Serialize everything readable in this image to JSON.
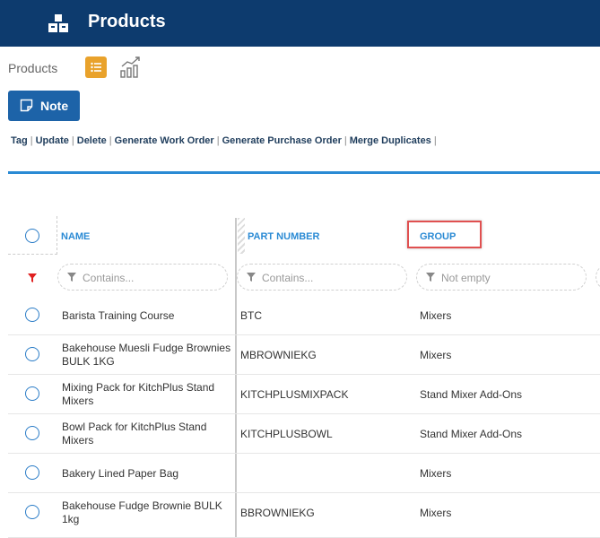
{
  "header": {
    "title": "Products",
    "logo_icon": "boxes-icon"
  },
  "subheader": {
    "breadcrumb": "Products",
    "list_view_icon": "list-icon",
    "chart_view_icon": "chart-icon"
  },
  "toolbar": {
    "note_label": "Note"
  },
  "actions": [
    "Tag",
    "Update",
    "Delete",
    "Generate Work Order",
    "Generate Purchase Order",
    "Merge Duplicates"
  ],
  "columns": {
    "name": "NAME",
    "part_number": "PART NUMBER",
    "group": "GROUP"
  },
  "filters": {
    "name_placeholder": "Contains...",
    "part_placeholder": "Contains...",
    "group_value": "Not empty"
  },
  "colors": {
    "topbar": "#0d3b6e",
    "accent": "#2a8ad4",
    "button": "#1d63a8",
    "active_view": "#e9a22b",
    "highlight": "#e05050"
  },
  "rows": [
    {
      "name": "Barista Training Course",
      "part": "BTC",
      "group": "Mixers"
    },
    {
      "name": "Bakehouse Muesli Fudge Brownies BULK 1KG",
      "part": "MBROWNIEKG",
      "group": "Mixers"
    },
    {
      "name": "Mixing Pack for KitchPlus Stand Mixers",
      "part": "KITCHPLUSMIXPACK",
      "group": "Stand Mixer Add-Ons"
    },
    {
      "name": "Bowl Pack for KitchPlus Stand Mixers",
      "part": "KITCHPLUSBOWL",
      "group": "Stand Mixer Add-Ons"
    },
    {
      "name": "Bakery Lined Paper Bag",
      "part": "",
      "group": "Mixers"
    },
    {
      "name": "Bakehouse Fudge Brownie BULK 1kg",
      "part": "BBROWNIEKG",
      "group": "Mixers"
    }
  ]
}
